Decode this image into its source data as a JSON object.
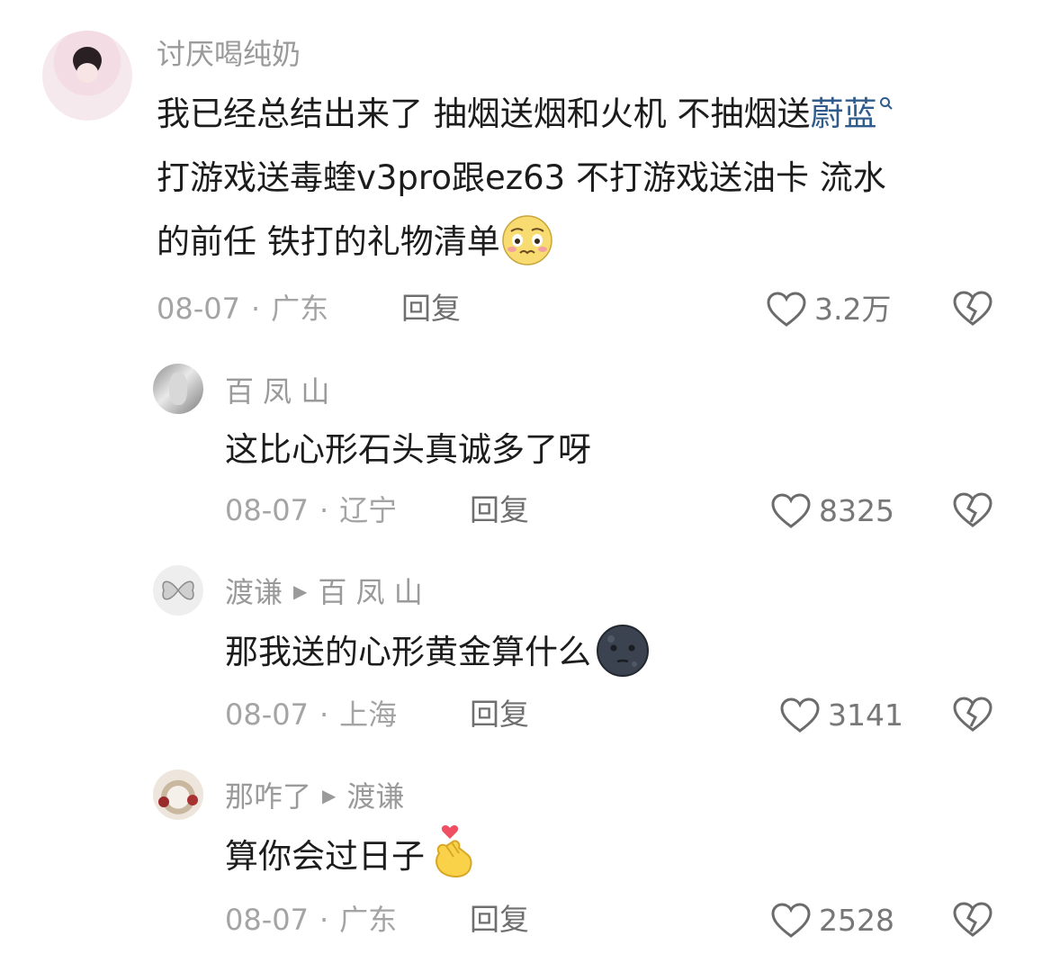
{
  "comments": [
    {
      "author": "讨厌喝纯奶",
      "text_lines": [
        "我已经总结出来了 抽烟送烟和火机 不抽烟送",
        "打游戏送毒蝰v3pro跟ez63 不打游戏送油卡 流水",
        "的前任 铁打的礼物清单"
      ],
      "keyword": "蔚蓝",
      "date": "08-07",
      "location": "广东",
      "reply_label": "回复",
      "likes": "3.2万"
    },
    {
      "author": "百 凤 山",
      "text": "这比心形石头真诚多了呀",
      "date": "08-07",
      "location": "辽宁",
      "reply_label": "回复",
      "likes": "8325"
    },
    {
      "author": "渡谦",
      "reply_to": "百 凤 山",
      "text": "那我送的心形黄金算什么",
      "date": "08-07",
      "location": "上海",
      "reply_label": "回复",
      "likes": "3141"
    },
    {
      "author": "那咋了",
      "reply_to": "渡谦",
      "text": "算你会过日子",
      "date": "08-07",
      "location": "广东",
      "reply_label": "回复",
      "likes": "2528"
    }
  ],
  "icons": {
    "like": "heart-outline-icon",
    "dislike": "broken-heart-icon",
    "search": "search-icon"
  },
  "colors": {
    "keyword": "#2f5c8d",
    "meta": "#a4a4a4",
    "text": "#1c1c1c"
  }
}
